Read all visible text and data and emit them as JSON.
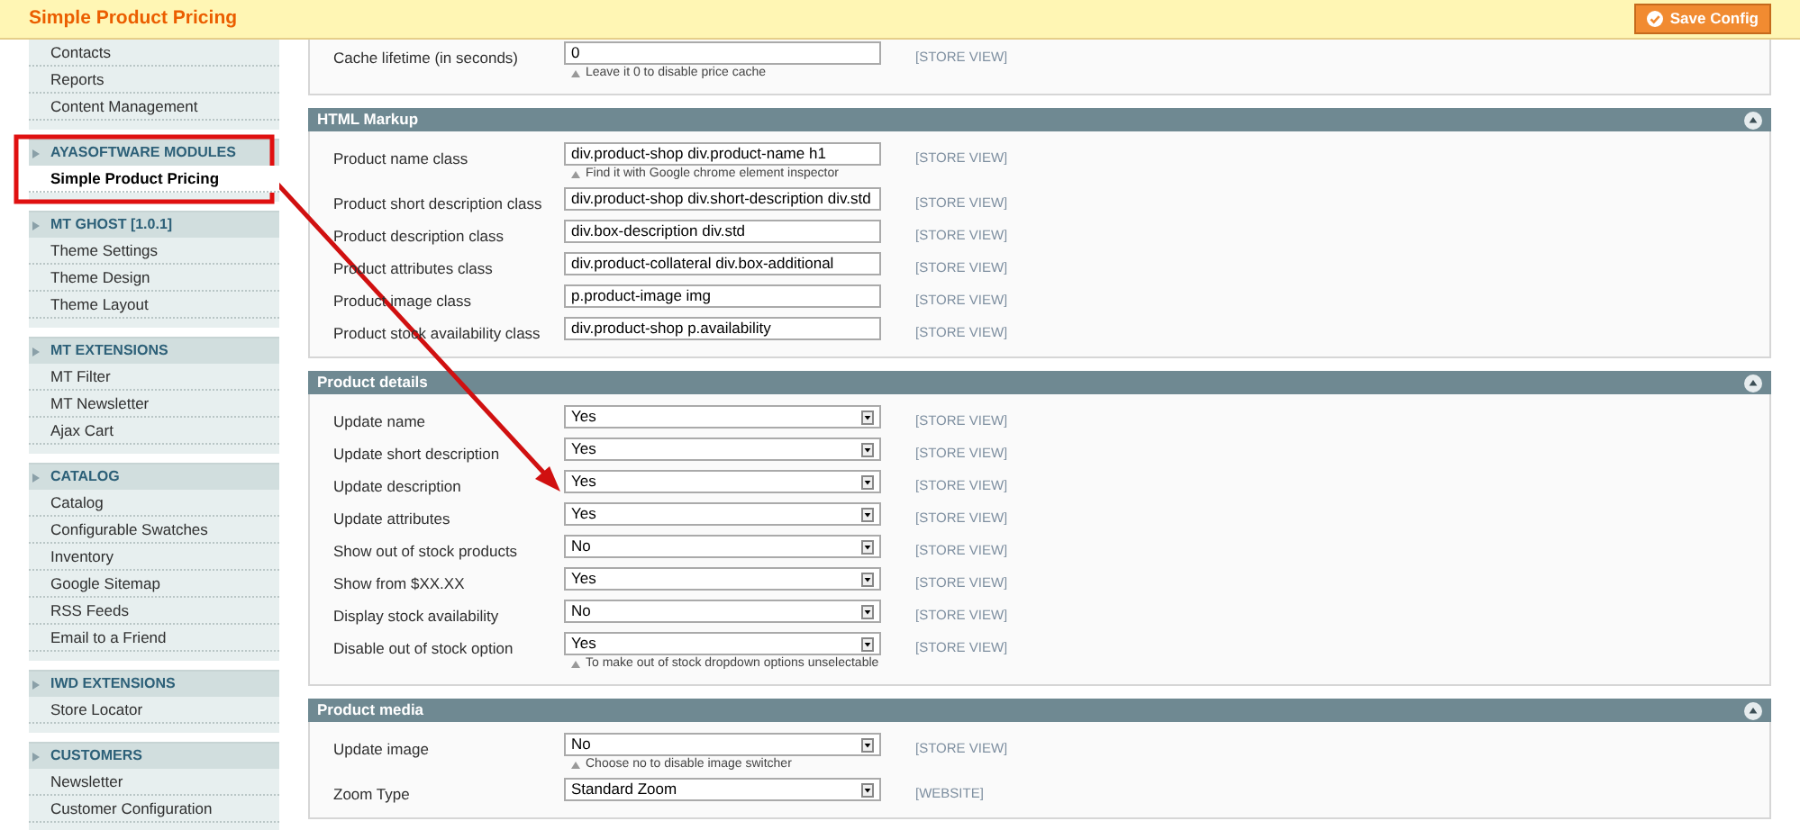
{
  "header": {
    "title": "Simple Product Pricing",
    "save_button": "Save Config"
  },
  "sidebar": {
    "groups": [
      {
        "items": [
          {
            "label": "Contacts",
            "selected": false
          },
          {
            "label": "Reports",
            "selected": false
          },
          {
            "label": "Content Management",
            "selected": false
          }
        ]
      },
      {
        "title": "AYASOFTWARE MODULES",
        "items": [
          {
            "label": "Simple Product Pricing",
            "selected": true
          }
        ]
      },
      {
        "title": "MT GHOST [1.0.1]",
        "items": [
          {
            "label": "Theme Settings",
            "selected": false
          },
          {
            "label": "Theme Design",
            "selected": false
          },
          {
            "label": "Theme Layout",
            "selected": false
          }
        ]
      },
      {
        "title": "MT EXTENSIONS",
        "items": [
          {
            "label": "MT Filter",
            "selected": false
          },
          {
            "label": "MT Newsletter",
            "selected": false
          },
          {
            "label": "Ajax Cart",
            "selected": false
          }
        ]
      },
      {
        "title": "CATALOG",
        "items": [
          {
            "label": "Catalog",
            "selected": false
          },
          {
            "label": "Configurable Swatches",
            "selected": false
          },
          {
            "label": "Inventory",
            "selected": false
          },
          {
            "label": "Google Sitemap",
            "selected": false
          },
          {
            "label": "RSS Feeds",
            "selected": false
          },
          {
            "label": "Email to a Friend",
            "selected": false
          }
        ]
      },
      {
        "title": "IWD EXTENSIONS",
        "items": [
          {
            "label": "Store Locator",
            "selected": false
          }
        ]
      },
      {
        "title": "CUSTOMERS",
        "items": [
          {
            "label": "Newsletter",
            "selected": false
          },
          {
            "label": "Customer Configuration",
            "selected": false
          }
        ]
      }
    ]
  },
  "sections": [
    {
      "rows": [
        {
          "kind": "text",
          "label": "Cache lifetime (in seconds)",
          "value": "0",
          "scope": "[STORE VIEW]",
          "note": "Leave it 0 to disable price cache"
        }
      ]
    },
    {
      "title": "HTML Markup",
      "rows": [
        {
          "kind": "text",
          "label": "Product name class",
          "value": "div.product-shop div.product-name h1",
          "scope": "[STORE VIEW]",
          "note": "Find it with Google chrome element inspector"
        },
        {
          "kind": "text",
          "label": "Product short description class",
          "value": "div.product-shop div.short-description div.std",
          "scope": "[STORE VIEW]"
        },
        {
          "kind": "text",
          "label": "Product description class",
          "value": "div.box-description div.std",
          "scope": "[STORE VIEW]"
        },
        {
          "kind": "text",
          "label": "Product attributes class",
          "value": "div.product-collateral div.box-additional",
          "scope": "[STORE VIEW]"
        },
        {
          "kind": "text",
          "label": "Product image class",
          "value": "p.product-image img",
          "scope": "[STORE VIEW]"
        },
        {
          "kind": "text",
          "label": "Product stock availability class",
          "value": "div.product-shop p.availability",
          "scope": "[STORE VIEW]"
        }
      ]
    },
    {
      "title": "Product details",
      "rows": [
        {
          "kind": "select",
          "label": "Update name",
          "value": "Yes",
          "scope": "[STORE VIEW]"
        },
        {
          "kind": "select",
          "label": "Update short description",
          "value": "Yes",
          "scope": "[STORE VIEW]"
        },
        {
          "kind": "select",
          "label": "Update description",
          "value": "Yes",
          "scope": "[STORE VIEW]"
        },
        {
          "kind": "select",
          "label": "Update attributes",
          "value": "Yes",
          "scope": "[STORE VIEW]"
        },
        {
          "kind": "select",
          "label": "Show out of stock products",
          "value": "No",
          "scope": "[STORE VIEW]"
        },
        {
          "kind": "select",
          "label": "Show from $XX.XX",
          "value": "Yes",
          "scope": "[STORE VIEW]"
        },
        {
          "kind": "select",
          "label": "Display stock availability",
          "value": "No",
          "scope": "[STORE VIEW]"
        },
        {
          "kind": "select",
          "label": "Disable out of stock option",
          "value": "Yes",
          "scope": "[STORE VIEW]",
          "note": "To make out of stock dropdown options unselectable"
        }
      ]
    },
    {
      "title": "Product media",
      "rows": [
        {
          "kind": "select",
          "label": "Update image",
          "value": "No",
          "scope": "[STORE VIEW]",
          "note": "Choose no to disable image switcher"
        },
        {
          "kind": "select",
          "label": "Zoom Type",
          "value": "Standard Zoom",
          "scope": "[WEBSITE]"
        }
      ]
    }
  ]
}
